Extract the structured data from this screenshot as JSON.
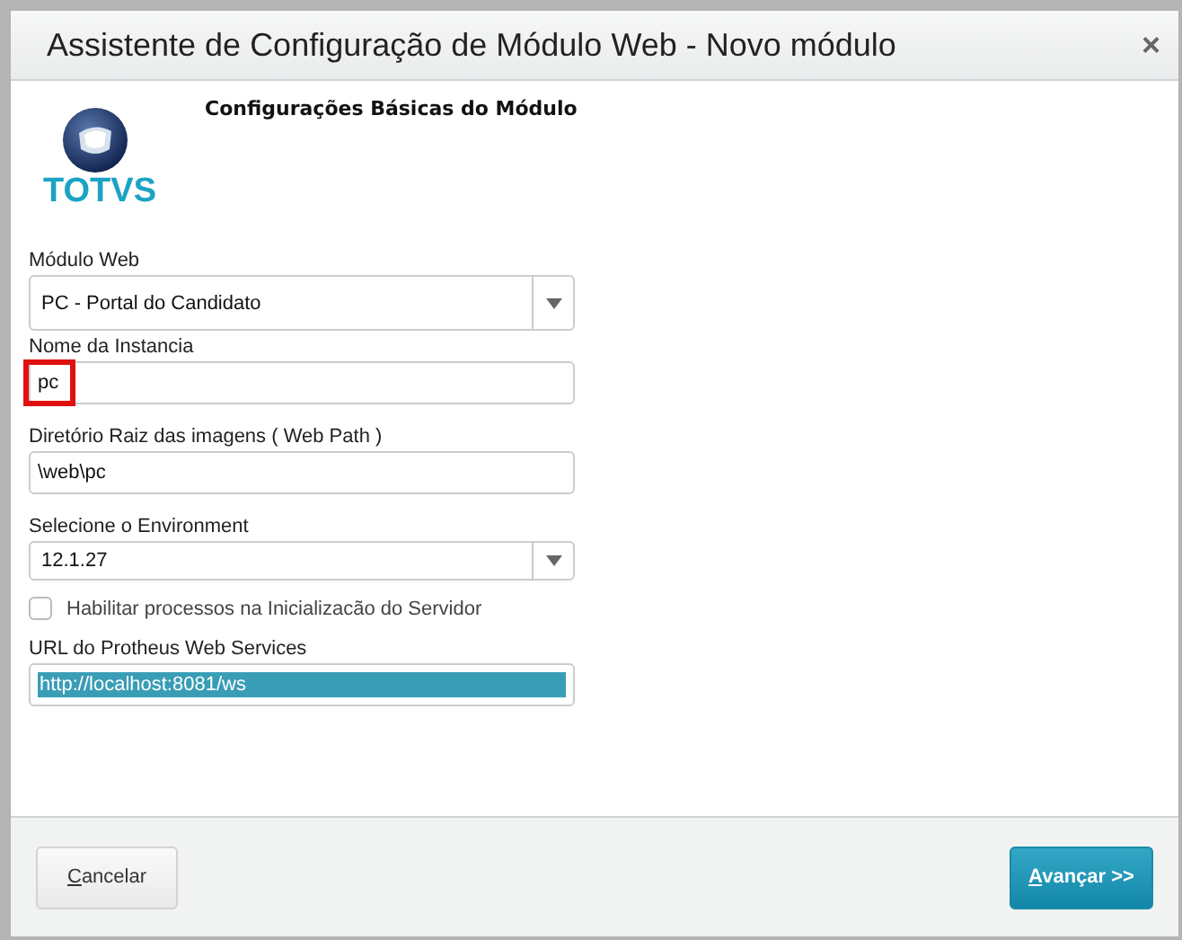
{
  "window": {
    "title": "Assistente de Configuração de Módulo Web - Novo módulo",
    "close": "×"
  },
  "logo": {
    "text": "TOTVS"
  },
  "section_title": "Configurações Básicas do Módulo",
  "fields": [
    {
      "kind": "select",
      "label": "Módulo Web",
      "value": "PC - Portal do Candidato",
      "tall": true
    },
    {
      "kind": "text",
      "label": "Nome da Instancia",
      "value": "pc",
      "highlighted": true
    },
    {
      "kind": "text",
      "label": "Diretório Raiz das imagens ( Web Path )",
      "value": "\\web\\pc"
    },
    {
      "kind": "select",
      "label": "Selecione o Environment",
      "value": "12.1.27"
    },
    {
      "kind": "checkbox",
      "label": "Habilitar processos na Inicializacão do Servidor",
      "checked": false
    },
    {
      "kind": "text",
      "label": "URL do Protheus Web Services",
      "value": "http://localhost:8081/ws",
      "text_selected": true
    }
  ],
  "buttons": [
    {
      "label": "Cancelar",
      "primary": false
    },
    {
      "label": "Avançar >>",
      "primary": true
    }
  ]
}
